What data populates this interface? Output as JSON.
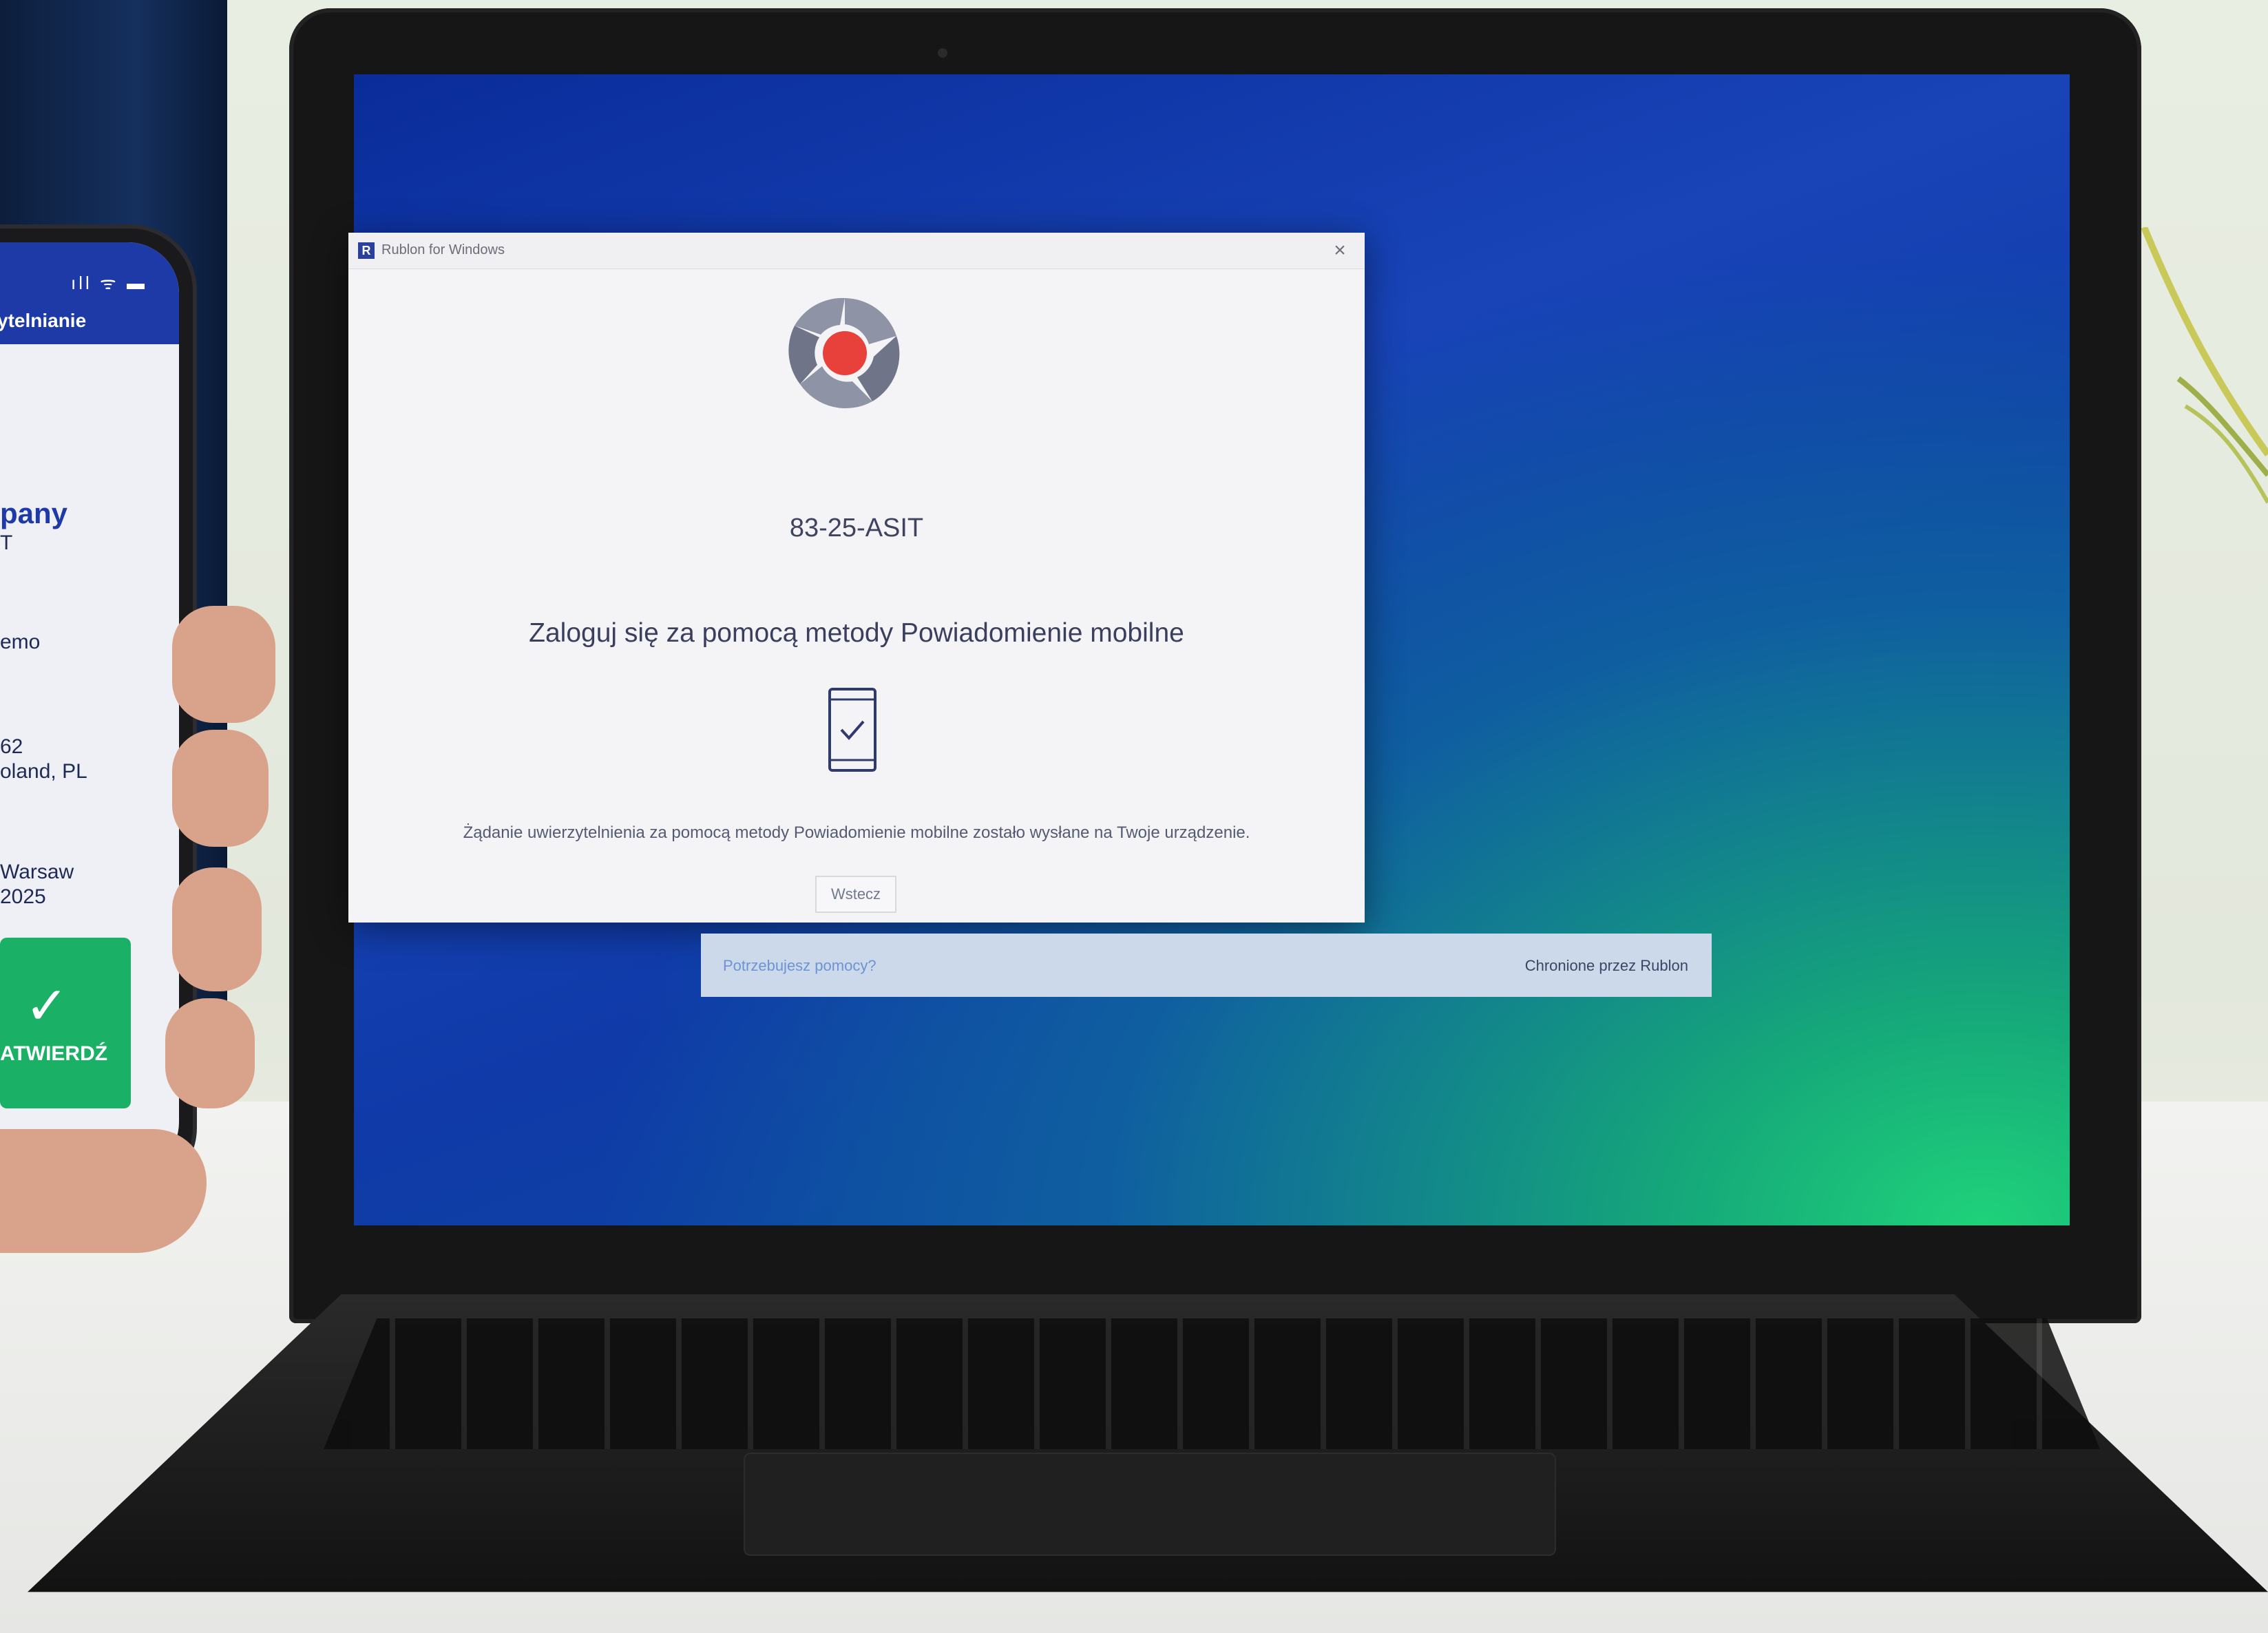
{
  "dialog": {
    "window_title": "Rublon for Windows",
    "app_icon_letter": "R",
    "close_glyph": "×",
    "device_code": "83-25-ASIT",
    "headline": "Zaloguj się za pomocą metody Powiadomienie mobilne",
    "message": "Żądanie uwierzytelnienia za pomocą metody Powiadomienie mobilne zostało wysłane na Twoje urządzenie.",
    "back_button": "Wstecz",
    "help_link": "Potrzebujesz pomocy?",
    "powered_by": "Chronione przez Rublon",
    "brand_accent": "#e8403a",
    "footer_color": "#cbd9ea"
  },
  "phone": {
    "header_title": "ytelnianie",
    "status_icons": "ıll ᯤ ▬",
    "lines": [
      "pany",
      "T",
      "emo",
      "62",
      "oland, PL",
      "Warsaw",
      "2025"
    ],
    "approve_label": "ATWIERDŹ",
    "approve_glyph": "✓",
    "approve_color": "#1ab065"
  }
}
